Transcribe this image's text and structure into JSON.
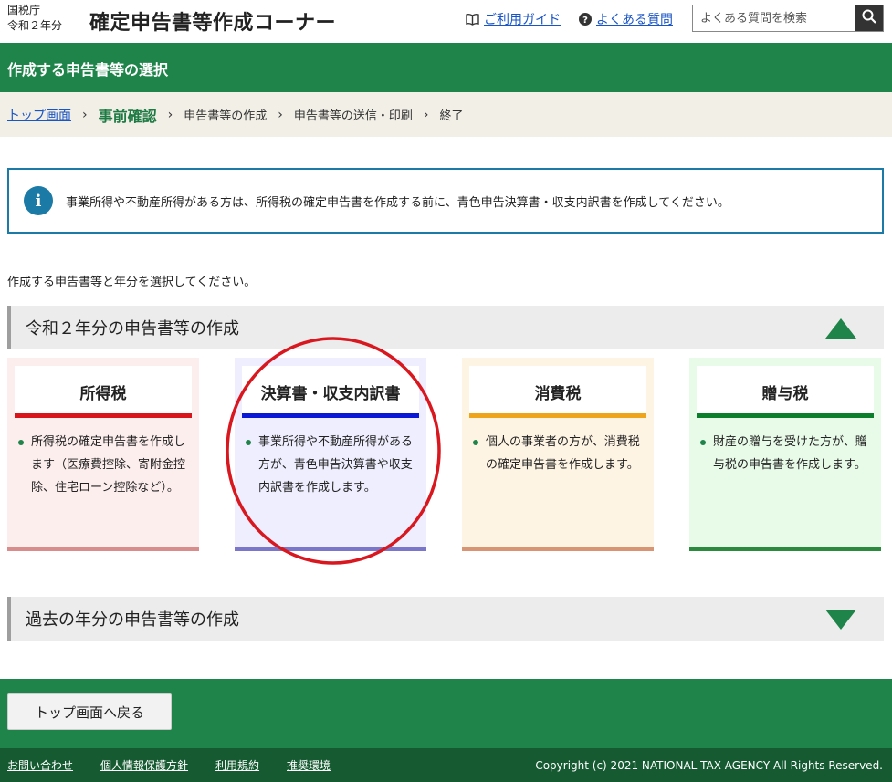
{
  "header": {
    "agency_line1": "国税庁",
    "agency_line2": "令和２年分",
    "site_title": "確定申告書等作成コーナー",
    "guide_link": "ご利用ガイド",
    "faq_link": "よくある質問",
    "search_placeholder": "よくある質問を検索"
  },
  "title_bar": "作成する申告書等の選択",
  "breadcrumb": {
    "top": "トップ画面",
    "current": "事前確認",
    "step3": "申告書等の作成",
    "step4": "申告書等の送信・印刷",
    "step5": "終了"
  },
  "info": {
    "icon": "i",
    "text": "事業所得や不動産所得がある方は、所得税の確定申告書を作成する前に、青色申告決算書・収支内訳書を作成してください。"
  },
  "instruction": "作成する申告書等と年分を選択してください。",
  "section_current": "令和２年分の申告書等の作成",
  "cards": [
    {
      "title": "所得税",
      "description": "所得税の確定申告書を作成します（医療費控除、寄附金控除、住宅ローン控除など）。"
    },
    {
      "title": "決算書・収支内訳書",
      "description": "事業所得や不動産所得がある方が、青色申告決算書や収支内訳書を作成します。"
    },
    {
      "title": "消費税",
      "description": "個人の事業者の方が、消費税の確定申告書を作成します。"
    },
    {
      "title": "贈与税",
      "description": "財産の贈与を受けた方が、贈与税の申告書を作成します。"
    }
  ],
  "section_past": "過去の年分の申告書等の作成",
  "back_button": "トップ画面へ戻る",
  "footer": {
    "links": [
      "お問い合わせ",
      "個人情報保護方針",
      "利用規約",
      "推奨環境"
    ],
    "copyright": "Copyright (c) 2021 NATIONAL TAX AGENCY All Rights Reserved."
  },
  "colors": {
    "brand_green": "#1e8449",
    "link_blue": "#1a55c6",
    "annotation_red": "#d8171f"
  }
}
